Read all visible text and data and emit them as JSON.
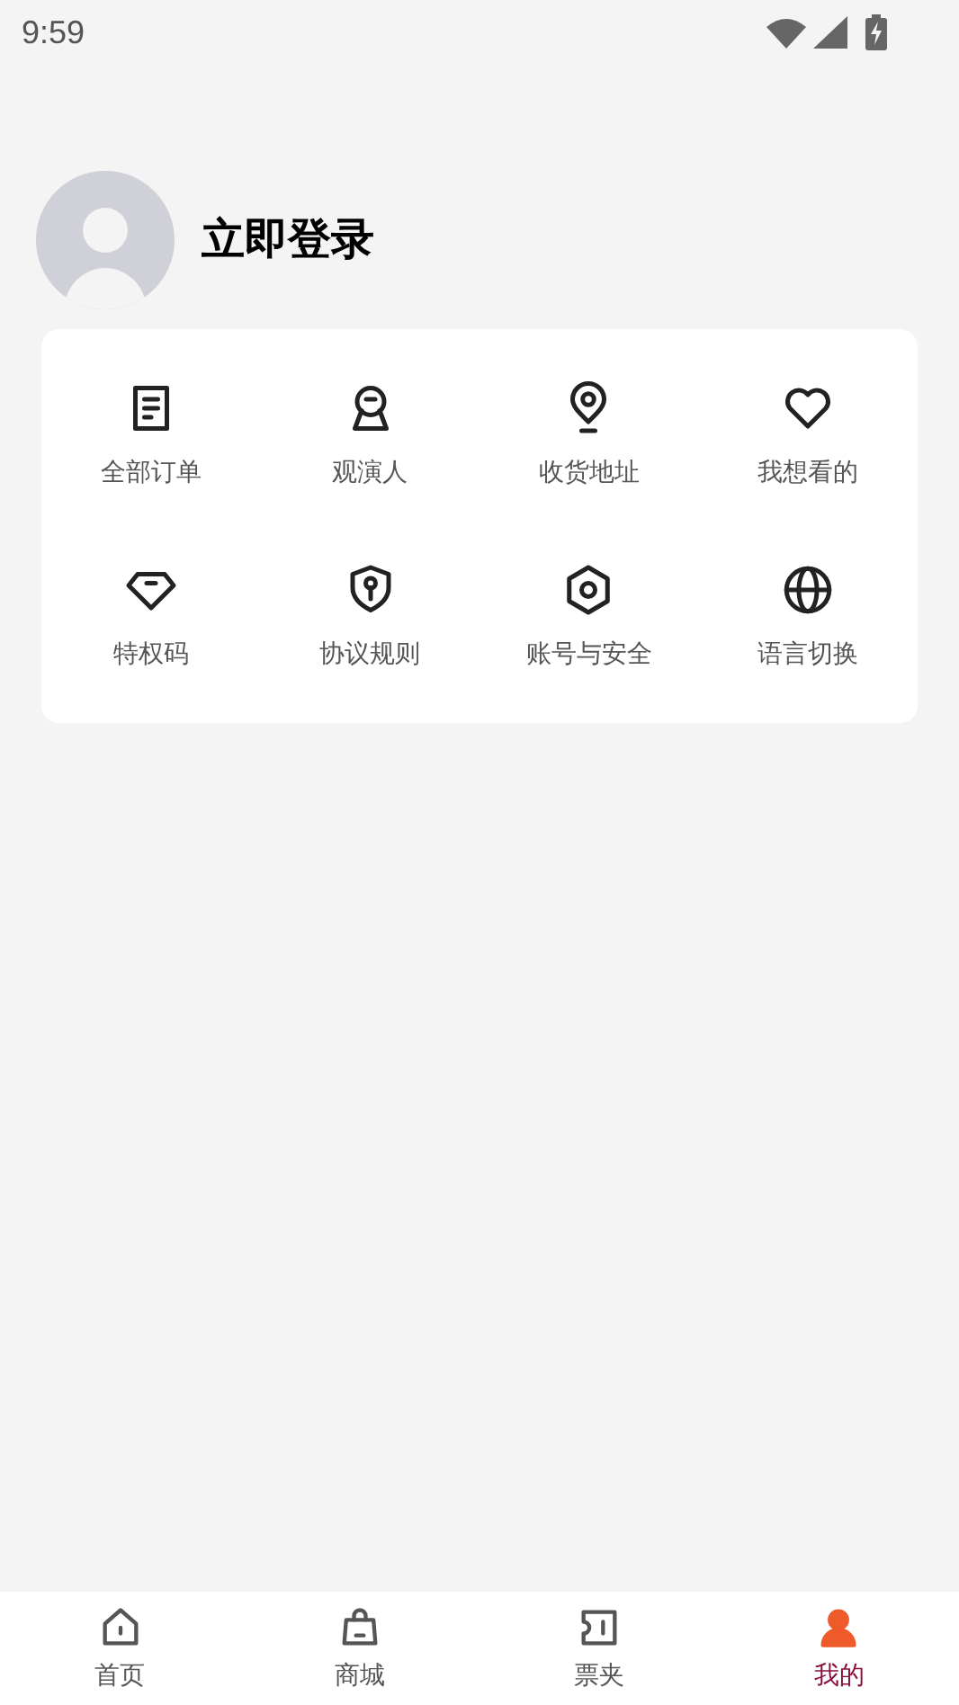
{
  "status_bar": {
    "time": "9:59"
  },
  "profile": {
    "login_label": "立即登录"
  },
  "menu": [
    {
      "label": "全部订单"
    },
    {
      "label": "观演人"
    },
    {
      "label": "收货地址"
    },
    {
      "label": "我想看的"
    },
    {
      "label": "特权码"
    },
    {
      "label": "协议规则"
    },
    {
      "label": "账号与安全"
    },
    {
      "label": "语言切换"
    }
  ],
  "tab_bar": [
    {
      "label": "首页",
      "selected": false
    },
    {
      "label": "商城",
      "selected": false
    },
    {
      "label": "票夹",
      "selected": false
    },
    {
      "label": "我的",
      "selected": true
    }
  ]
}
